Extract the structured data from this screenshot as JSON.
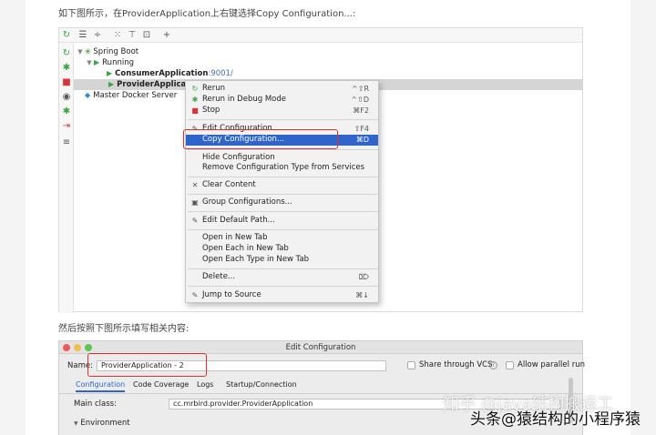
{
  "captions": {
    "top": "如下图所示，在ProviderApplication上右键选择Copy Configuration...:",
    "middle": "然后按照下图所示填写相关内容:"
  },
  "toolbar": {
    "icons": [
      "rerun-icon",
      "expand-all-icon",
      "collapse-all-icon",
      "group-icon",
      "filter-icon",
      "layout-icon",
      "add-icon"
    ],
    "glyphs": [
      "↻",
      "☰",
      "÷",
      "⁙",
      "⊤",
      "⊡",
      "+"
    ]
  },
  "sidebar": {
    "glyphs": [
      "↻",
      "✱",
      "■",
      "◉",
      "✱",
      "⇥",
      "≡"
    ]
  },
  "tree": {
    "spring_boot": "Spring Boot",
    "running": "Running",
    "consumer": "ConsumerApplication",
    "consumer_port": ":9001/",
    "provider": "ProviderApplicati",
    "docker": "Master Docker Server"
  },
  "menu": {
    "rerun": {
      "label": "Rerun",
      "shortcut": "^⇧R",
      "icon": "↻"
    },
    "debug": {
      "label": "Rerun in Debug Mode",
      "shortcut": "^⇧D",
      "icon": "✱"
    },
    "stop": {
      "label": "Stop",
      "shortcut": "⌘F2",
      "icon": "■"
    },
    "edit": {
      "label": "Edit Configuration...",
      "shortcut": "⇧F4",
      "icon": "✎"
    },
    "copy": {
      "label": "Copy Configuration...",
      "shortcut": "⌘D"
    },
    "hide": {
      "label": "Hide Configuration"
    },
    "remove": {
      "label": "Remove Configuration Type from Services"
    },
    "clear": {
      "label": "Clear Content",
      "icon": "✕"
    },
    "group": {
      "label": "Group Configurations...",
      "icon": "▣"
    },
    "default_path": {
      "label": "Edit Default Path...",
      "icon": "✎"
    },
    "open_new": {
      "label": "Open in New Tab"
    },
    "open_each": {
      "label": "Open Each in New Tab"
    },
    "open_type": {
      "label": "Open Each Type in New Tab"
    },
    "delete": {
      "label": "Delete...",
      "shortcut": "⌦"
    },
    "jump": {
      "label": "Jump to Source",
      "shortcut": "⌘↓",
      "icon": "✎"
    }
  },
  "dialog": {
    "title": "Edit Configuration",
    "name_label": "Name:",
    "name_value": "ProviderApplication - 2",
    "share_label": "Share through VCS",
    "help": "?",
    "parallel_label": "Allow parallel run",
    "tabs": [
      "Configuration",
      "Code Coverage",
      "Logs",
      "Startup/Connection"
    ],
    "main_class_label": "Main class:",
    "main_class_value": "cc.mrbird.provider.ProviderApplication",
    "environment_label": "Environment"
  },
  "watermarks": {
    "line1": "知乎 @java结构搬运工",
    "line2": "头条@猿结构的小程序猿"
  },
  "colors": {
    "accent": "#2f65ca",
    "annotation_red": "#e0302a",
    "run_green": "#38a540"
  }
}
